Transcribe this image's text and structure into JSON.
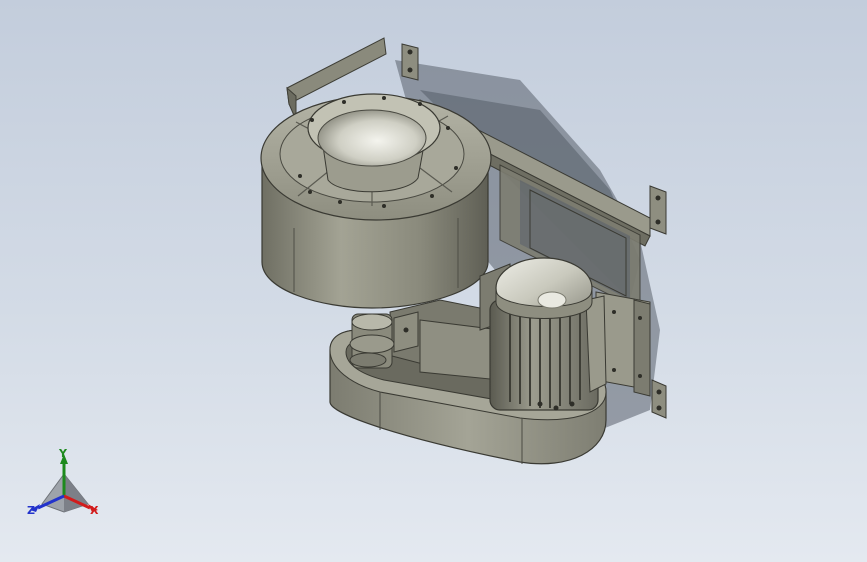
{
  "viewport": {
    "background_top": "#c3cddc",
    "background_bottom": "#e4e9f0",
    "model_color": "#8e8e80",
    "model_shadow_color": "#4e5560"
  },
  "triad": {
    "x_label": "X",
    "y_label": "Y",
    "z_label": "Z",
    "x_color": "#d21c1c",
    "y_color": "#1d8a1d",
    "z_color": "#2233cc"
  }
}
